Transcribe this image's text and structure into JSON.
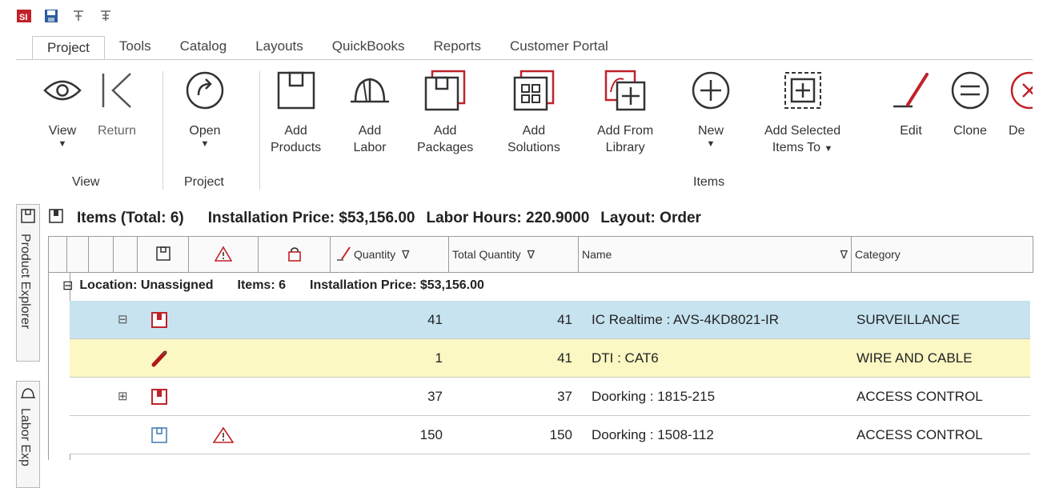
{
  "quick_access": {
    "icons": [
      "app-logo-icon",
      "save-icon",
      "pin-icon",
      "pin-icon"
    ]
  },
  "tabs": [
    "Project",
    "Tools",
    "Catalog",
    "Layouts",
    "QuickBooks",
    "Reports",
    "Customer Portal"
  ],
  "ribbon": {
    "view": {
      "label": "View"
    },
    "return": {
      "label": "Return"
    },
    "open": {
      "label": "Open"
    },
    "add_products": {
      "line1": "Add",
      "line2": "Products"
    },
    "add_labor": {
      "line1": "Add",
      "line2": "Labor"
    },
    "add_packages": {
      "line1": "Add",
      "line2": "Packages"
    },
    "add_solutions": {
      "line1": "Add",
      "line2": "Solutions"
    },
    "add_from_library": {
      "line1": "Add From",
      "line2": "Library"
    },
    "new": {
      "label": "New"
    },
    "add_selected": {
      "line1": "Add Selected",
      "line2": "Items To"
    },
    "edit": {
      "label": "Edit"
    },
    "clone": {
      "label": "Clone"
    },
    "delete": {
      "label": "De"
    },
    "groups": {
      "view": "View",
      "project": "Project",
      "items": "Items"
    }
  },
  "side_tabs": {
    "product_explorer": "Product Explorer",
    "labor_explorer": "Labor Exp"
  },
  "grid": {
    "title": {
      "items": "Items (Total: 6)",
      "price": "Installation Price: $53,156.00",
      "hours": "Labor Hours: 220.9000",
      "layout": "Layout: Order"
    },
    "columns": {
      "quantity": "Quantity",
      "total_quantity": "Total Quantity",
      "name": "Name",
      "category": "Category"
    },
    "group": {
      "location": "Location: Unassigned",
      "items": "Items: 6",
      "price": "Installation Price: $53,156.00"
    },
    "rows": [
      {
        "expander": "−",
        "qty": "41",
        "total": "41",
        "name": "IC Realtime : AVS-4KD8021-IR",
        "category": "SURVEILLANCE",
        "bg": "#c7e3f0"
      },
      {
        "expander": "",
        "qty": "1",
        "total": "41",
        "name": "DTI : CAT6",
        "category": "WIRE AND CABLE",
        "bg": "#fbf8c4"
      },
      {
        "expander": "+",
        "qty": "37",
        "total": "37",
        "name": "Doorking : 1815-215",
        "category": "ACCESS CONTROL",
        "bg": "#ffffff"
      },
      {
        "expander": "",
        "qty": "150",
        "total": "150",
        "name": "Doorking : 1508-112",
        "category": "ACCESS CONTROL",
        "bg": "#ffffff"
      }
    ]
  },
  "colors": {
    "accent_red": "#c0222a",
    "selected_row": "#c7e3f0",
    "highlight_row": "#fbf8c4",
    "border": "#9a9a9a"
  }
}
